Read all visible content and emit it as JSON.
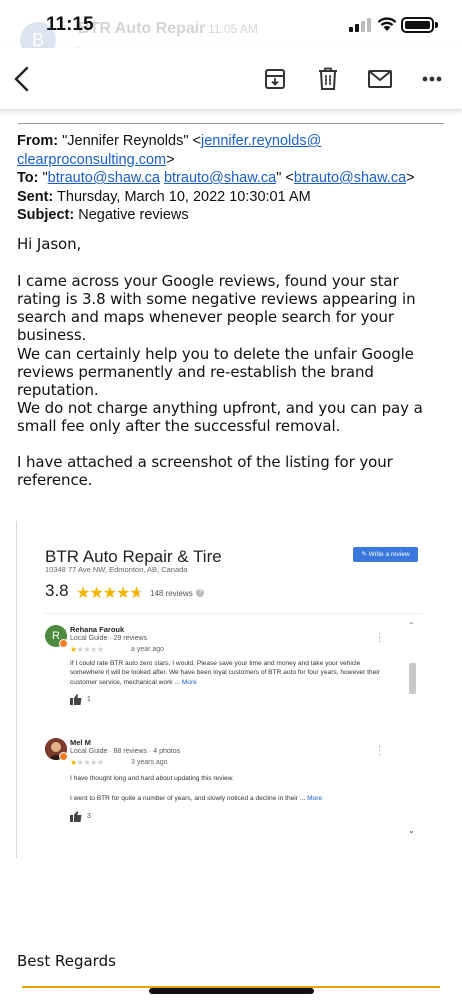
{
  "status_bar": {
    "time": "11:15"
  },
  "ghost_header": {
    "avatar_letter": "B",
    "sender": "BTR Auto Repair",
    "time": "11:05 AM",
    "to": "to me ›"
  },
  "email": {
    "from_label": "From:",
    "from_name": "\"Jennifer Reynolds\" <",
    "from_email_1": "jennifer.reynolds@",
    "from_email_2": "clearproconsulting.com",
    "from_close": ">",
    "to_label": "To:",
    "to_open": "\"",
    "to_email_1": "btrauto@shaw.ca",
    "to_email_2": "btrauto@shaw.ca",
    "to_mid": "\" <",
    "to_email_3": "btrauto@shaw.ca",
    "to_close": ">",
    "sent_label": "Sent:",
    "sent_value": "Thursday, March 10, 2022 10:30:01 AM",
    "subject_label": "Subject:",
    "subject_value": "Negative reviews",
    "greeting": "Hi Jason,",
    "p1": "I came across your Google reviews, found your star rating is 3.8 with some negative reviews appearing in search and maps whenever people search for your business.",
    "p2": "We can certainly help you to delete the unfair Google reviews permanently and re-establish the brand reputation.",
    "p3": "We do not charge anything upfront, and you can pay a small fee only after the successful removal.",
    "p4": "I have attached a screenshot of the listing for your reference.",
    "signoff": "Best Regards"
  },
  "listing": {
    "business_name": "BTR Auto Repair & Tire",
    "address": "10348 77 Ave NW, Edmonton, AB, Canada",
    "rating": "3.8",
    "rating_stars": 3.8,
    "review_count": "148 reviews",
    "write_review": "Write a review",
    "reviews": [
      {
        "initial": "R",
        "avatar_color": "#4e8a3e",
        "name": "Rehana Farouk",
        "guide": "Local Guide · 29 reviews",
        "stars": 1,
        "when": "a year ago",
        "text": "If I could rate BTR auto zero stars, I would. Please save your time and money and take your vehicle somewhere it will be looked after. We have been loyal customers of BTR auto for four years, however their customer service, mechanical work ...",
        "more": "More",
        "likes": "1"
      },
      {
        "initial": "",
        "avatar_color": "#7a3b2e",
        "name": "Mel M",
        "guide": "Local Guide · 88 reviews · 4 photos",
        "stars": 1,
        "when": "3 years ago",
        "text_1": "I have thought long and hard about updating this review.",
        "text_2": "I went to BTR for quite a number of years, and slowly noticed a decline in their ...",
        "more": "More",
        "likes": "3"
      }
    ]
  },
  "icons": {
    "back": "chevron-left-icon",
    "archive": "archive-icon",
    "trash": "trash-icon",
    "mail": "mail-icon",
    "more": "more-horizontal-icon"
  },
  "colors": {
    "link": "#1a5fd0",
    "star": "#f4b400",
    "write_button": "#3a78de"
  }
}
